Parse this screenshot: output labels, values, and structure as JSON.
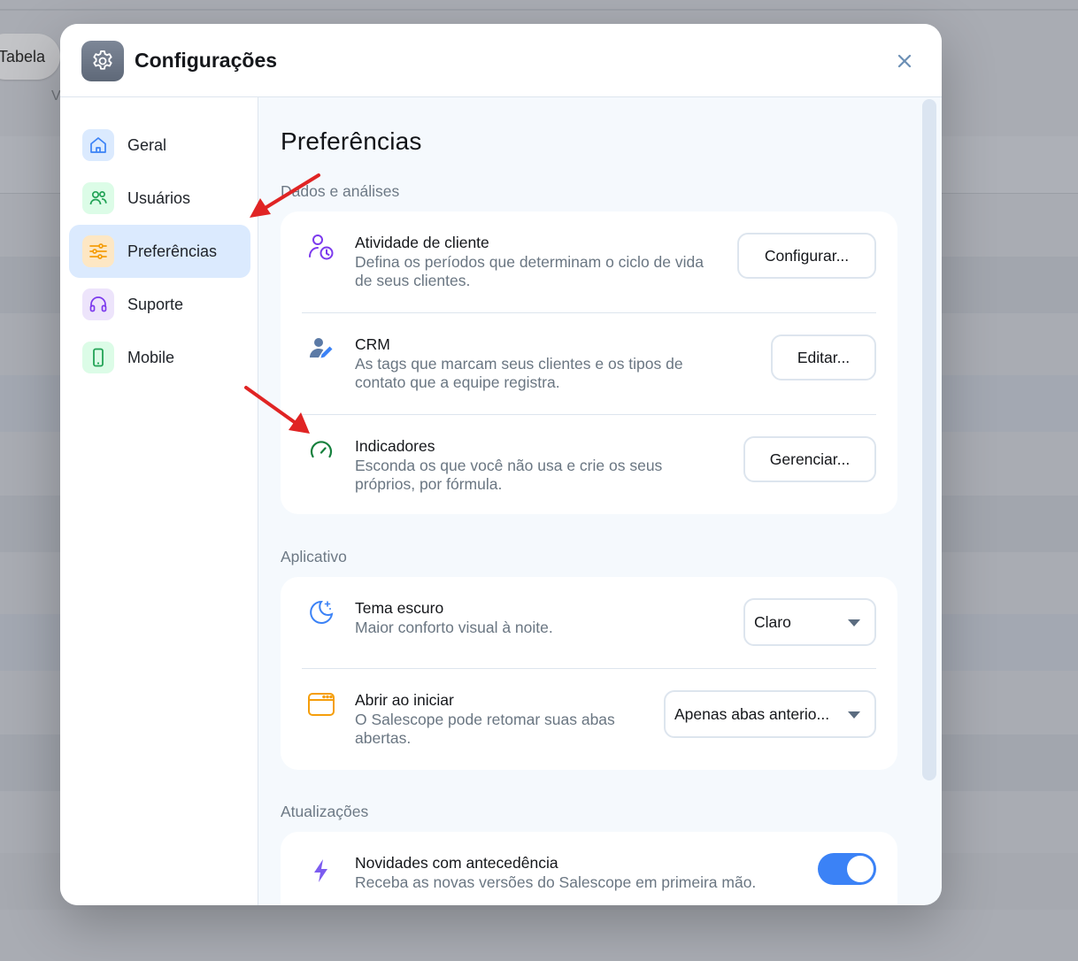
{
  "background": {
    "tab_label": "Tabela",
    "partial_text": "V"
  },
  "modal": {
    "title": "Configurações",
    "header_icon": "gear-icon",
    "close_icon": "close-icon"
  },
  "sidebar": {
    "items": [
      {
        "label": "Geral",
        "icon": "home-icon",
        "active": false
      },
      {
        "label": "Usuários",
        "icon": "users-icon",
        "active": false
      },
      {
        "label": "Preferências",
        "icon": "sliders-icon",
        "active": true
      },
      {
        "label": "Suporte",
        "icon": "headset-icon",
        "active": false
      },
      {
        "label": "Mobile",
        "icon": "phone-icon",
        "active": false
      }
    ]
  },
  "content": {
    "page_title": "Preferências",
    "sections": [
      {
        "title": "Dados e análises",
        "rows": [
          {
            "title": "Atividade de cliente",
            "description_lines": [
              "Defina os períodos que determinam o ciclo de vida",
              "de seus clientes."
            ],
            "button": "Configurar...",
            "icon": "user-clock-icon"
          },
          {
            "title": "CRM",
            "description_lines": [
              "As tags que marcam seus clientes e os tipos de",
              "contato que a equipe registra."
            ],
            "button": "Editar...",
            "icon": "user-edit-icon"
          },
          {
            "title": "Indicadores",
            "description_lines": [
              "Esconda os que você não usa e crie os seus",
              "próprios, por fórmula."
            ],
            "button": "Gerenciar...",
            "icon": "gauge-icon"
          }
        ]
      },
      {
        "title": "Aplicativo",
        "rows": [
          {
            "title": "Tema escuro",
            "description_lines": [
              "Maior conforto visual à noite."
            ],
            "select_value": "Claro",
            "icon": "moon-stars-icon"
          },
          {
            "title": "Abrir ao iniciar",
            "description_lines": [
              "O Salescope pode retomar suas abas",
              "abertas."
            ],
            "select_value": "Apenas abas anterio...",
            "icon": "browser-window-icon"
          }
        ]
      },
      {
        "title": "Atualizações",
        "rows": [
          {
            "title": "Novidades com antecedência",
            "description_lines": [
              "Receba as novas versões do Salescope em primeira mão."
            ],
            "toggle_on": true,
            "icon": "lightning-icon"
          }
        ]
      }
    ]
  },
  "annotations": {
    "arrow_color": "#e02424"
  }
}
